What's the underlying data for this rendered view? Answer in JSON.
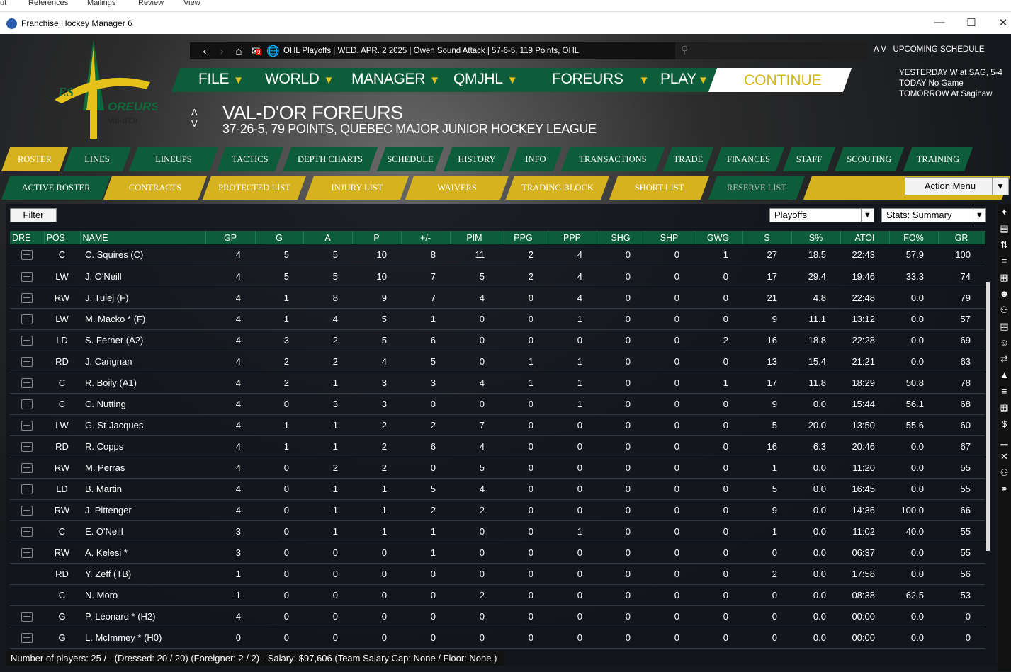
{
  "word_menu": [
    "ut",
    "References",
    "Mailings",
    "Review",
    "View"
  ],
  "window": {
    "title": "Franchise Hockey Manager 6"
  },
  "topstrip": {
    "mail_count": "9",
    "info": "OHL Playoffs | WED. APR. 2 2025 | Owen Sound Attack | 57-6-5, 119 Points, OHL"
  },
  "nav": [
    {
      "label": "FILE"
    },
    {
      "label": "WORLD"
    },
    {
      "label": "MANAGER"
    },
    {
      "label": "QMJHL"
    },
    {
      "label": "FOREURS"
    },
    {
      "label": "PLAY"
    }
  ],
  "continue_label": "CONTINUE",
  "schedule": {
    "title": "UPCOMING SCHEDULE",
    "arrows": "Λ V",
    "lines": [
      "YESTERDAY W at SAG, 5-4",
      "TODAY No Game",
      "TOMORROW At Saginaw"
    ]
  },
  "team": {
    "name": "VAL-D'OR FOREURS",
    "record": "37-26-5, 79 POINTS, QUEBEC MAJOR JUNIOR HOCKEY LEAGUE",
    "logo_text": "Les Foreurs Val-d'Or"
  },
  "tabs1": [
    "ROSTER",
    "LINES",
    "LINEUPS",
    "TACTICS",
    "DEPTH CHARTS",
    "SCHEDULE",
    "HISTORY",
    "INFO",
    "TRANSACTIONS",
    "TRADE",
    "FINANCES",
    "STAFF",
    "SCOUTING",
    "TRAINING"
  ],
  "tabs2": [
    "ACTIVE ROSTER",
    "CONTRACTS",
    "PROTECTED LIST",
    "INJURY LIST",
    "WAIVERS",
    "TRADING BLOCK",
    "SHORT LIST",
    "RESERVE LIST"
  ],
  "action_menu": "Action Menu",
  "filter_label": "Filter",
  "season_select": "Playoffs",
  "stats_select": "Stats: Summary",
  "columns": [
    "DRE",
    "POS",
    "NAME",
    "GP",
    "G",
    "A",
    "P",
    "+/-",
    "PIM",
    "PPG",
    "PPP",
    "SHG",
    "SHP",
    "GWG",
    "S",
    "S%",
    "ATOI",
    "FO%",
    "GR"
  ],
  "rows": [
    {
      "dressed": true,
      "cells": [
        "C",
        "C. Squires (C)",
        "4",
        "5",
        "5",
        "10",
        "8",
        "11",
        "2",
        "4",
        "0",
        "0",
        "1",
        "27",
        "18.5",
        "22:43",
        "57.9",
        "100"
      ]
    },
    {
      "dressed": true,
      "cells": [
        "LW",
        "J. O'Neill",
        "4",
        "5",
        "5",
        "10",
        "7",
        "5",
        "2",
        "4",
        "0",
        "0",
        "0",
        "17",
        "29.4",
        "19:46",
        "33.3",
        "74"
      ]
    },
    {
      "dressed": true,
      "cells": [
        "RW",
        "J. Tulej (F)",
        "4",
        "1",
        "8",
        "9",
        "7",
        "4",
        "0",
        "4",
        "0",
        "0",
        "0",
        "21",
        "4.8",
        "22:48",
        "0.0",
        "79"
      ]
    },
    {
      "dressed": true,
      "cells": [
        "LW",
        "M. Macko * (F)",
        "4",
        "1",
        "4",
        "5",
        "1",
        "0",
        "0",
        "1",
        "0",
        "0",
        "0",
        "9",
        "11.1",
        "13:12",
        "0.0",
        "57"
      ]
    },
    {
      "dressed": true,
      "cells": [
        "LD",
        "S. Ferner (A2)",
        "4",
        "3",
        "2",
        "5",
        "6",
        "0",
        "0",
        "0",
        "0",
        "0",
        "2",
        "16",
        "18.8",
        "22:28",
        "0.0",
        "69"
      ]
    },
    {
      "dressed": true,
      "cells": [
        "RD",
        "J. Carignan",
        "4",
        "2",
        "2",
        "4",
        "5",
        "0",
        "1",
        "1",
        "0",
        "0",
        "0",
        "13",
        "15.4",
        "21:21",
        "0.0",
        "63"
      ]
    },
    {
      "dressed": true,
      "cells": [
        "C",
        "R. Boily (A1)",
        "4",
        "2",
        "1",
        "3",
        "3",
        "4",
        "1",
        "1",
        "0",
        "0",
        "1",
        "17",
        "11.8",
        "18:29",
        "50.8",
        "78"
      ]
    },
    {
      "dressed": true,
      "cells": [
        "C",
        "C. Nutting",
        "4",
        "0",
        "3",
        "3",
        "0",
        "0",
        "0",
        "1",
        "0",
        "0",
        "0",
        "9",
        "0.0",
        "15:44",
        "56.1",
        "68"
      ]
    },
    {
      "dressed": true,
      "cells": [
        "LW",
        "G. St-Jacques",
        "4",
        "1",
        "1",
        "2",
        "2",
        "7",
        "0",
        "0",
        "0",
        "0",
        "0",
        "5",
        "20.0",
        "13:50",
        "55.6",
        "60"
      ]
    },
    {
      "dressed": true,
      "cells": [
        "RD",
        "R. Copps",
        "4",
        "1",
        "1",
        "2",
        "6",
        "4",
        "0",
        "0",
        "0",
        "0",
        "0",
        "16",
        "6.3",
        "20:46",
        "0.0",
        "67"
      ]
    },
    {
      "dressed": true,
      "cells": [
        "RW",
        "M. Perras",
        "4",
        "0",
        "2",
        "2",
        "0",
        "5",
        "0",
        "0",
        "0",
        "0",
        "0",
        "1",
        "0.0",
        "11:20",
        "0.0",
        "55"
      ]
    },
    {
      "dressed": true,
      "cells": [
        "LD",
        "B. Martin",
        "4",
        "0",
        "1",
        "1",
        "5",
        "4",
        "0",
        "0",
        "0",
        "0",
        "0",
        "5",
        "0.0",
        "16:45",
        "0.0",
        "55"
      ]
    },
    {
      "dressed": true,
      "cells": [
        "RW",
        "J. Pittenger",
        "4",
        "0",
        "1",
        "1",
        "2",
        "2",
        "0",
        "0",
        "0",
        "0",
        "0",
        "9",
        "0.0",
        "14:36",
        "100.0",
        "66"
      ]
    },
    {
      "dressed": true,
      "cells": [
        "C",
        "E. O'Neill",
        "3",
        "0",
        "1",
        "1",
        "1",
        "0",
        "0",
        "1",
        "0",
        "0",
        "0",
        "1",
        "0.0",
        "11:02",
        "40.0",
        "55"
      ]
    },
    {
      "dressed": true,
      "cells": [
        "RW",
        "A. Kelesi *",
        "3",
        "0",
        "0",
        "0",
        "1",
        "0",
        "0",
        "0",
        "0",
        "0",
        "0",
        "0",
        "0.0",
        "06:37",
        "0.0",
        "55"
      ]
    },
    {
      "dressed": false,
      "cells": [
        "RD",
        "Y. Zeff (TB)",
        "1",
        "0",
        "0",
        "0",
        "0",
        "0",
        "0",
        "0",
        "0",
        "0",
        "0",
        "2",
        "0.0",
        "17:58",
        "0.0",
        "56"
      ]
    },
    {
      "dressed": false,
      "cells": [
        "C",
        "N. Moro",
        "1",
        "0",
        "0",
        "0",
        "0",
        "2",
        "0",
        "0",
        "0",
        "0",
        "0",
        "0",
        "0.0",
        "08:38",
        "62.5",
        "53"
      ]
    },
    {
      "dressed": true,
      "cells": [
        "G",
        "P. Léonard * (H2)",
        "4",
        "0",
        "0",
        "0",
        "0",
        "0",
        "0",
        "0",
        "0",
        "0",
        "0",
        "0",
        "0.0",
        "00:00",
        "0.0",
        "0"
      ]
    },
    {
      "dressed": true,
      "cells": [
        "G",
        "L. McImmey * (H0)",
        "0",
        "0",
        "0",
        "0",
        "0",
        "0",
        "0",
        "0",
        "0",
        "0",
        "0",
        "0",
        "0.0",
        "00:00",
        "0.0",
        "0"
      ]
    }
  ],
  "status": "Number of players: 25 / - (Dressed: 20 / 20) (Foreigner: 2 / 2) -   Salary: $97,606  (Team Salary Cap: None / Floor: None )",
  "colors": {
    "green": "#0d5c3a",
    "gold": "#d6b21e"
  }
}
